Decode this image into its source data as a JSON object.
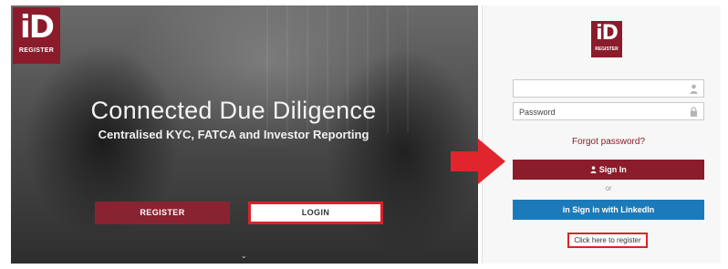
{
  "colors": {
    "brand": "#8a1c2b",
    "highlight": "#d8232a",
    "linkedin": "#1d7ab8"
  },
  "hero": {
    "logo_text": "iD",
    "logo_subtext": "REGISTER",
    "title": "Connected Due Diligence",
    "subtitle": "Centralised KYC, FATCA and Investor Reporting",
    "register_label": "REGISTER",
    "login_label": "LOGIN",
    "scroll_icon": "chevron-down-icon"
  },
  "arrow": {
    "icon": "right-arrow-icon",
    "color": "#e0262c"
  },
  "login_panel": {
    "logo_text": "iD",
    "logo_subtext": "REGISTER",
    "email_value": "",
    "email_icon": "user-icon",
    "password_placeholder": "Password",
    "password_icon": "lock-icon",
    "forgot_label": "Forgot password?",
    "signin_label": "Sign In",
    "signin_icon": "user-icon",
    "or_label": "or",
    "linkedin_label": "Sign in with LinkedIn",
    "linkedin_icon_text": "in",
    "register_link_label": "Click here to register"
  }
}
